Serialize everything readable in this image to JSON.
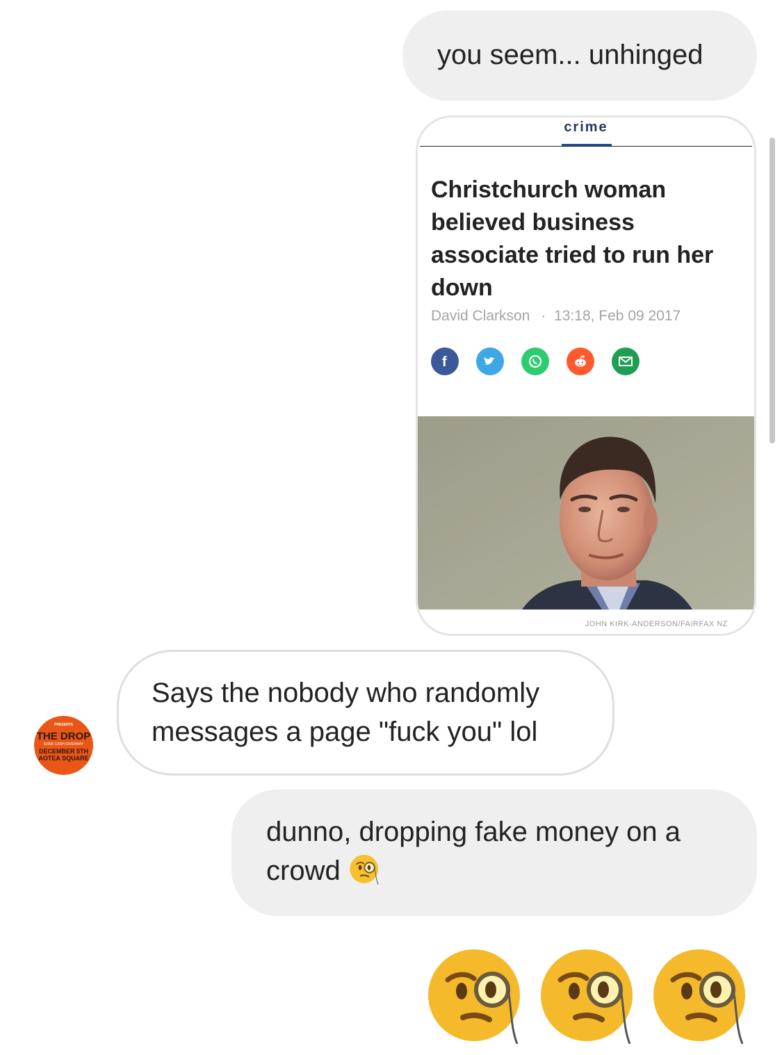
{
  "messages": {
    "out_1": "you seem... unhinged",
    "in_1_line1": "Says the nobody who randomly",
    "in_1_line2": "messages a page \"fuck you\" lol",
    "out_2_line1": "dunno, dropping fake money on a",
    "out_2_line2": "crowd",
    "emoji_reaction": [
      "monocle-face",
      "monocle-face",
      "monocle-face"
    ]
  },
  "shared_article": {
    "section": "crime",
    "headline_lines": [
      "Christchurch woman",
      "believed business",
      "associate tried to run her",
      "down"
    ],
    "author": "David Clarkson",
    "separator": "·",
    "timestamp": "13:18, Feb 09 2017",
    "share_buttons": [
      {
        "icon": "facebook-icon",
        "color": "#3b5998"
      },
      {
        "icon": "twitter-icon",
        "color": "#3ea7e5"
      },
      {
        "icon": "whatsapp-icon",
        "color": "#2ecc71"
      },
      {
        "icon": "reddit-icon",
        "color": "#ff5a2d"
      },
      {
        "icon": "email-icon",
        "color": "#1f9d55"
      }
    ],
    "photo_credit": "JOHN KIRK-ANDERSON/FAIRFAX NZ"
  },
  "sender": {
    "avatar_lines": [
      "PRESENTS",
      "THE DROP",
      "$100K CASH GIVEAWAY",
      "DECEMBER 5TH",
      "AOTEA SQUARE"
    ],
    "avatar_color": "#f05a1a"
  }
}
